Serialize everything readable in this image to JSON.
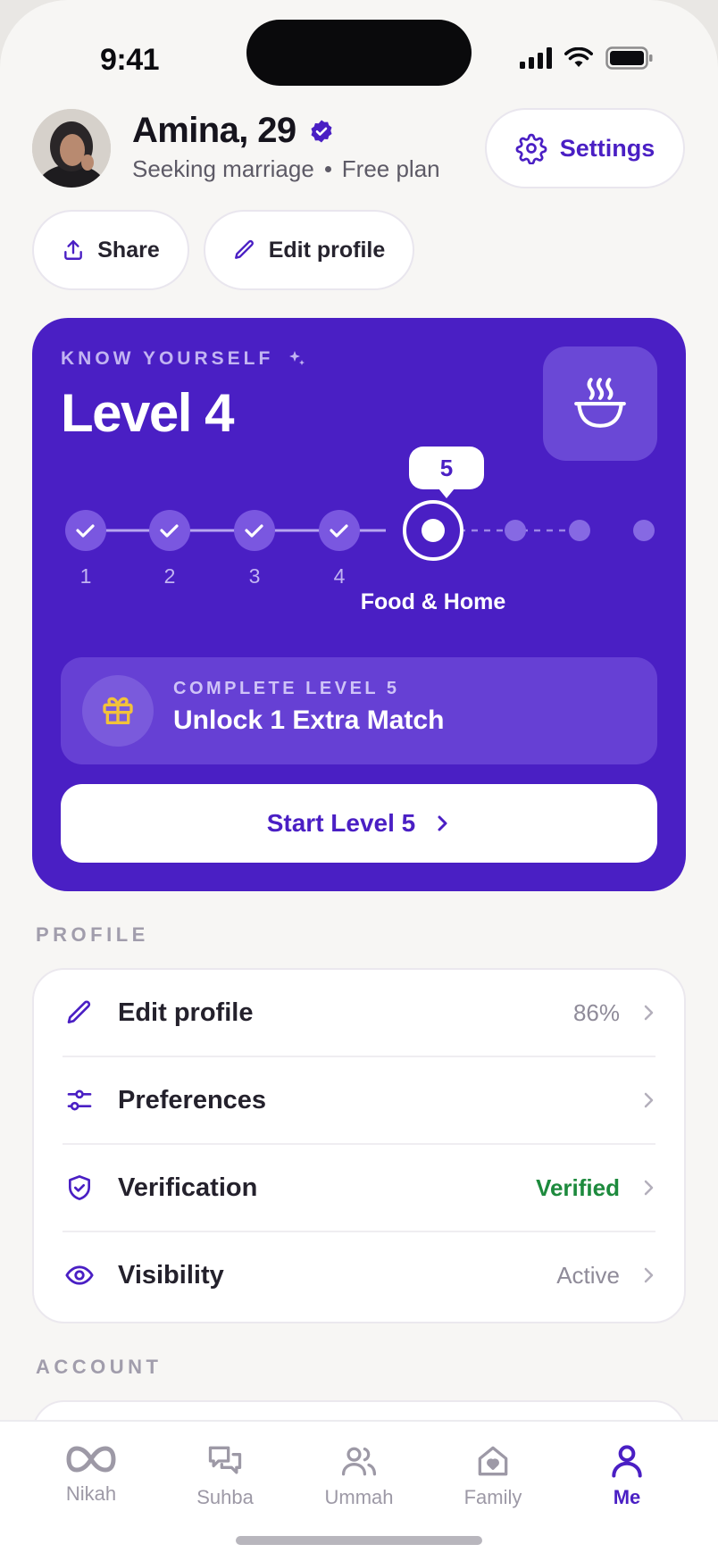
{
  "status_bar": {
    "time": "9:41"
  },
  "header": {
    "name": "Amina, 29",
    "status": "Seeking marriage",
    "plan": "Free plan",
    "settings_label": "Settings",
    "share_label": "Share",
    "edit_profile_label": "Edit profile"
  },
  "level_card": {
    "kicker": "KNOW YOURSELF",
    "title": "Level 4",
    "steps": [
      "1",
      "2",
      "3",
      "4"
    ],
    "completed_steps": 4,
    "total_steps": 8,
    "current_step": "5",
    "current_step_name": "Food & Home",
    "reward_kicker": "COMPLETE LEVEL 5",
    "reward_title": "Unlock 1 Extra Match",
    "start_label": "Start Level 5"
  },
  "profile_section": {
    "label": "PROFILE",
    "items": [
      {
        "label": "Edit profile",
        "value": "86%",
        "icon": "pencil-icon"
      },
      {
        "label": "Preferences",
        "value": "",
        "icon": "sliders-icon"
      },
      {
        "label": "Verification",
        "value": "Verified",
        "icon": "shield-check-icon"
      },
      {
        "label": "Visibility",
        "value": "Active",
        "icon": "eye-icon"
      }
    ]
  },
  "account_section": {
    "label": "ACCOUNT"
  },
  "tabbar": {
    "tabs": [
      {
        "label": "Nikah",
        "icon": "infinity-icon"
      },
      {
        "label": "Suhba",
        "icon": "chat-bubbles-icon"
      },
      {
        "label": "Ummah",
        "icon": "people-icon"
      },
      {
        "label": "Family",
        "icon": "home-heart-icon"
      },
      {
        "label": "Me",
        "icon": "person-icon"
      }
    ],
    "active": "Me"
  },
  "colors": {
    "brand": "#4a1fc4",
    "success": "#1d8a3d",
    "reward_gold": "#f2c23a"
  }
}
